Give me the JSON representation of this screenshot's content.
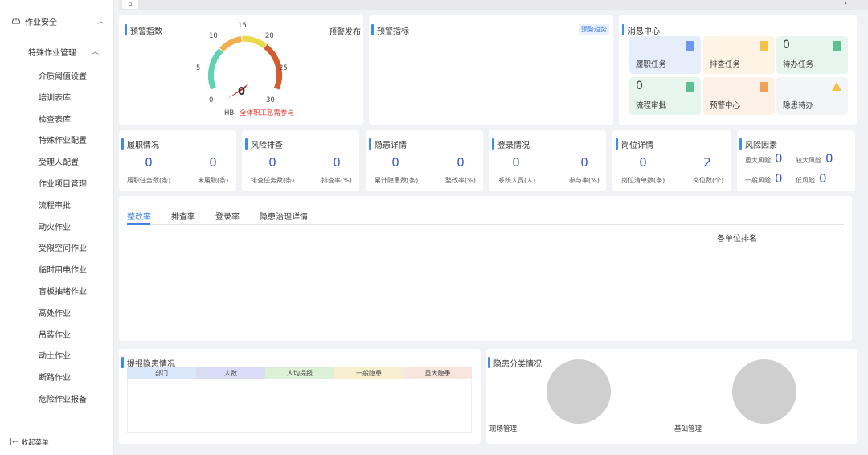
{
  "sidebar": {
    "top_label": "作业安全",
    "sub_label": "特殊作业管理",
    "items": [
      "介质阈值设置",
      "培训表库",
      "检查表库",
      "特殊作业配置",
      "受理人配置",
      "作业项目管理",
      "流程审批",
      "动火作业",
      "受限空间作业",
      "临时用电作业",
      "盲板抽堵作业",
      "高处作业",
      "吊装作业",
      "动土作业",
      "断路作业",
      "危险作业报备"
    ],
    "collapse_label": "收起菜单"
  },
  "warning_index": {
    "title": "预警指数",
    "publish_label": "预警发布",
    "gauge": {
      "value": 0,
      "min": 0,
      "max": 30,
      "ticks": [
        "0",
        "5",
        "10",
        "15",
        "20",
        "25",
        "30"
      ],
      "unit": "HB",
      "note": "全体职工急需参与"
    }
  },
  "warning_indicator": {
    "title": "预警指标",
    "trend_label": "预警趋势"
  },
  "message_center": {
    "title": "消息中心",
    "tiles": [
      {
        "label": "履职任务",
        "value": ""
      },
      {
        "label": "排查任务",
        "value": ""
      },
      {
        "label": "待办任务",
        "value": "0"
      },
      {
        "label": "流程审批",
        "value": "0"
      },
      {
        "label": "预警中心",
        "value": ""
      },
      {
        "label": "隐患待办",
        "value": ""
      }
    ],
    "colors": {
      "blue": "#e6eefc",
      "orange": "#fdf4e6",
      "green": "#e7f5ef",
      "grey": "#f4f5f7"
    }
  },
  "stats": [
    {
      "title": "履职情况",
      "a_value": "0",
      "a_label": "履职任务数(条)",
      "b_value": "0",
      "b_label": "未履职(条)"
    },
    {
      "title": "风险排查",
      "a_value": "0",
      "a_label": "排查任务数(条)",
      "b_value": "0",
      "b_label": "排查率(%)"
    },
    {
      "title": "隐患详情",
      "a_value": "0",
      "a_label": "累计隐患数(条)",
      "b_value": "0",
      "b_label": "整改率(%)"
    },
    {
      "title": "登录情况",
      "a_value": "0",
      "a_label": "系统人员(人)",
      "b_value": "0",
      "b_label": "参与率(%)"
    },
    {
      "title": "岗位详情",
      "a_value": "0",
      "a_label": "岗位清单数(条)",
      "b_value": "2",
      "b_label": "岗位数(个)"
    }
  ],
  "risk_factors": {
    "title": "风险因素",
    "items": [
      {
        "label": "重大风险",
        "value": "0"
      },
      {
        "label": "较大风险",
        "value": "0"
      },
      {
        "label": "一般风险",
        "value": "0"
      },
      {
        "label": "低风险",
        "value": "0"
      }
    ]
  },
  "tabs": [
    "整改率",
    "排查率",
    "登录率",
    "隐患治理详情"
  ],
  "ranking_title": "各单位排名",
  "report": {
    "title": "提报隐患情况",
    "columns": [
      {
        "label": "部门",
        "color": "#dbe7fb"
      },
      {
        "label": "人数",
        "color": "#d9dcf5"
      },
      {
        "label": "人均提报",
        "color": "#dcefd7"
      },
      {
        "label": "一般隐患",
        "color": "#f8efcf"
      },
      {
        "label": "重大隐患",
        "color": "#f8e5de"
      }
    ]
  },
  "category": {
    "title": "隐患分类情况",
    "labels": [
      "现场管理",
      "基础管理"
    ]
  },
  "accent_color": "#3f8cf0"
}
